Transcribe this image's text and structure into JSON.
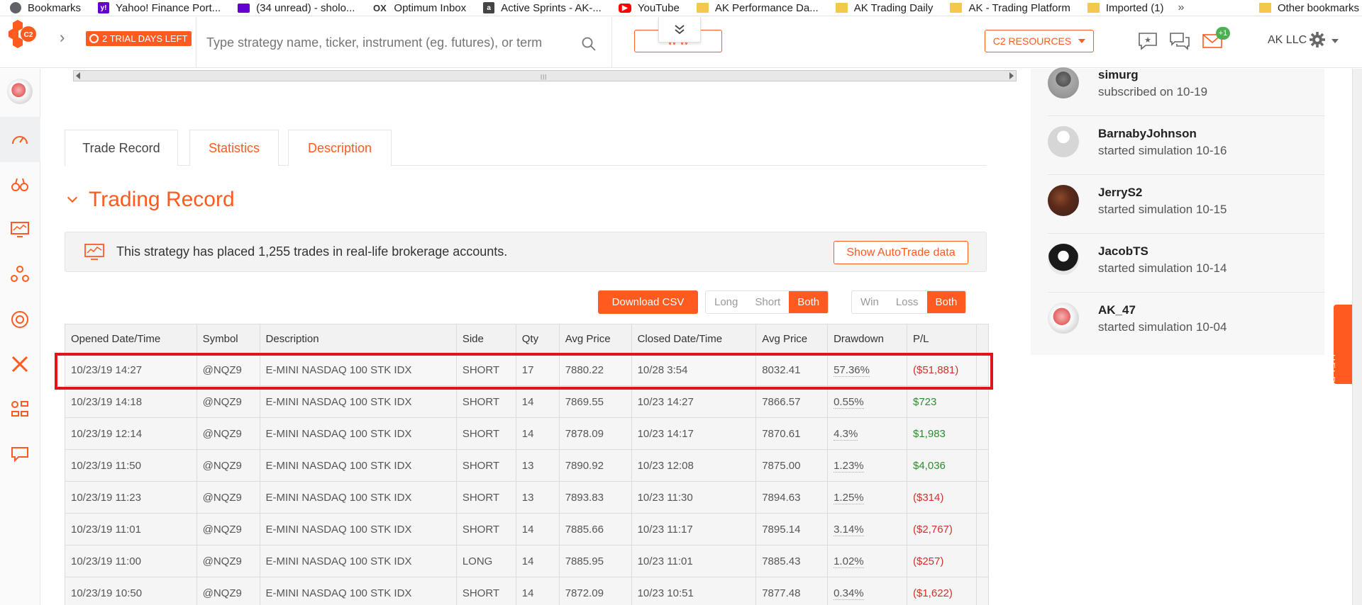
{
  "bookmarks": [
    {
      "label": "Bookmarks",
      "icon": "globe-icon"
    },
    {
      "label": "Yahoo! Finance Port...",
      "icon": "yahoo-icon"
    },
    {
      "label": "(34 unread) - sholo...",
      "icon": "mail-icon"
    },
    {
      "label": "Optimum Inbox",
      "icon": "ox-icon"
    },
    {
      "label": "Active Sprints - AK-...",
      "icon": "atlassian-icon"
    },
    {
      "label": "YouTube",
      "icon": "youtube-icon"
    },
    {
      "label": "AK Performance Da...",
      "icon": "folder-icon"
    },
    {
      "label": "AK Trading Daily",
      "icon": "folder-icon"
    },
    {
      "label": "AK - Trading Platform",
      "icon": "folder-icon"
    },
    {
      "label": "Imported (1)",
      "icon": "folder-icon"
    }
  ],
  "bookmarks_more": "»",
  "bookmarks_other": "Other bookmarks",
  "topnav": {
    "logo_text": "C2",
    "trial_label": "2 TRIAL DAYS LEFT",
    "search_placeholder": "Type strategy name, ticker, instrument (eg. futures), or term",
    "watch_label": "WATCH NOW",
    "watch_visible": "W        W",
    "resources_label": "C2 RESOURCES",
    "messages_badge": "+1",
    "account_label": "AK LLC"
  },
  "tabs": [
    "Trade Record",
    "Statistics",
    "Description"
  ],
  "section_title": "Trading Record",
  "info": {
    "text": "This strategy has placed 1,255 trades in real-life brokerage accounts.",
    "button": "Show AutoTrade data"
  },
  "toolbar": {
    "download": "Download CSV",
    "side_filter": [
      "Long",
      "Short",
      "Both"
    ],
    "result_filter": [
      "Win",
      "Loss",
      "Both"
    ]
  },
  "table": {
    "columns": [
      "Opened Date/Time",
      "Symbol",
      "Description",
      "Side",
      "Qty",
      "Avg Price",
      "Closed Date/Time",
      "Avg Price",
      "Drawdown",
      "P/L"
    ],
    "rows": [
      [
        "10/23/19 14:27",
        "@NQZ9",
        "E-MINI NASDAQ 100 STK IDX",
        "SHORT",
        "17",
        "7880.22",
        "10/28 3:54",
        "8032.41",
        "57.36%",
        "($51,881)"
      ],
      [
        "10/23/19 14:18",
        "@NQZ9",
        "E-MINI NASDAQ 100 STK IDX",
        "SHORT",
        "14",
        "7869.55",
        "10/23 14:27",
        "7866.57",
        "0.55%",
        "$723"
      ],
      [
        "10/23/19 12:14",
        "@NQZ9",
        "E-MINI NASDAQ 100 STK IDX",
        "SHORT",
        "14",
        "7878.09",
        "10/23 14:17",
        "7870.61",
        "4.3%",
        "$1,983"
      ],
      [
        "10/23/19 11:50",
        "@NQZ9",
        "E-MINI NASDAQ 100 STK IDX",
        "SHORT",
        "13",
        "7890.92",
        "10/23 12:08",
        "7875.00",
        "1.23%",
        "$4,036"
      ],
      [
        "10/23/19 11:23",
        "@NQZ9",
        "E-MINI NASDAQ 100 STK IDX",
        "SHORT",
        "13",
        "7893.83",
        "10/23 11:30",
        "7894.63",
        "1.25%",
        "($314)"
      ],
      [
        "10/23/19 11:01",
        "@NQZ9",
        "E-MINI NASDAQ 100 STK IDX",
        "SHORT",
        "14",
        "7885.66",
        "10/23 11:17",
        "7895.14",
        "3.14%",
        "($2,767)"
      ],
      [
        "10/23/19 11:00",
        "@NQZ9",
        "E-MINI NASDAQ 100 STK IDX",
        "LONG",
        "14",
        "7885.95",
        "10/23 11:01",
        "7885.43",
        "1.02%",
        "($257)"
      ],
      [
        "10/23/19 10:50",
        "@NQZ9",
        "E-MINI NASDAQ 100 STK IDX",
        "SHORT",
        "14",
        "7872.09",
        "10/23 10:51",
        "7877.48",
        "0.34%",
        "($1,622)"
      ]
    ]
  },
  "activity": [
    {
      "name": "simurg",
      "desc": "subscribed on 10-19"
    },
    {
      "name": "BarnabyJohnson",
      "desc": "started simulation 10-16"
    },
    {
      "name": "JerryS2",
      "desc": "started simulation 10-15"
    },
    {
      "name": "JacobTS",
      "desc": "started simulation 10-14"
    },
    {
      "name": "AK_47",
      "desc": "started simulation 10-04"
    }
  ],
  "help_label": "HELP",
  "colors": {
    "accent": "#ff5a1f",
    "positive": "#2e8b2e",
    "negative": "#d0312d",
    "highlight": "#e3131b"
  }
}
